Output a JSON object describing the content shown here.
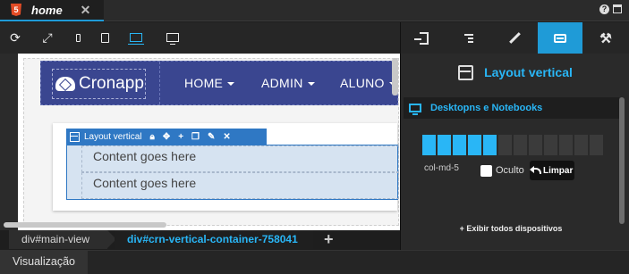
{
  "tab": {
    "title": "home",
    "close": "✕"
  },
  "window": {
    "help": "?"
  },
  "devices": [
    {
      "name": "refresh"
    },
    {
      "name": "expand"
    },
    {
      "name": "phone"
    },
    {
      "name": "tablet"
    },
    {
      "name": "laptop",
      "active": true
    },
    {
      "name": "monitor"
    }
  ],
  "canvas": {
    "logo_text": "Cronapp",
    "nav": [
      "HOME",
      "ADMIN",
      "ALUNO"
    ],
    "layout_toolbar_label": "Layout vertical",
    "rows": [
      "Content goes here",
      "Content goes here"
    ]
  },
  "breadcrumb": {
    "items": [
      "div#main-view",
      "div#crn-vertical-container-758041"
    ],
    "add": "+"
  },
  "statusbar": {
    "label": "Visualização"
  },
  "panel": {
    "title": "Layout vertical",
    "section_title": "Desktopns e Notebooks",
    "grid": {
      "total": 12,
      "selected": 5
    },
    "col_class": "col-md-5",
    "hidden_label": "Oculto",
    "clear_label": "Limpar",
    "show_all": "+ Exibir todos dispositivos"
  },
  "colors": {
    "accent": "#1f9bd7",
    "accent_text": "#29b6f6",
    "navbar": "#3a4690",
    "selection": "#2f78c4",
    "container_bg": "#d6e3f1"
  }
}
